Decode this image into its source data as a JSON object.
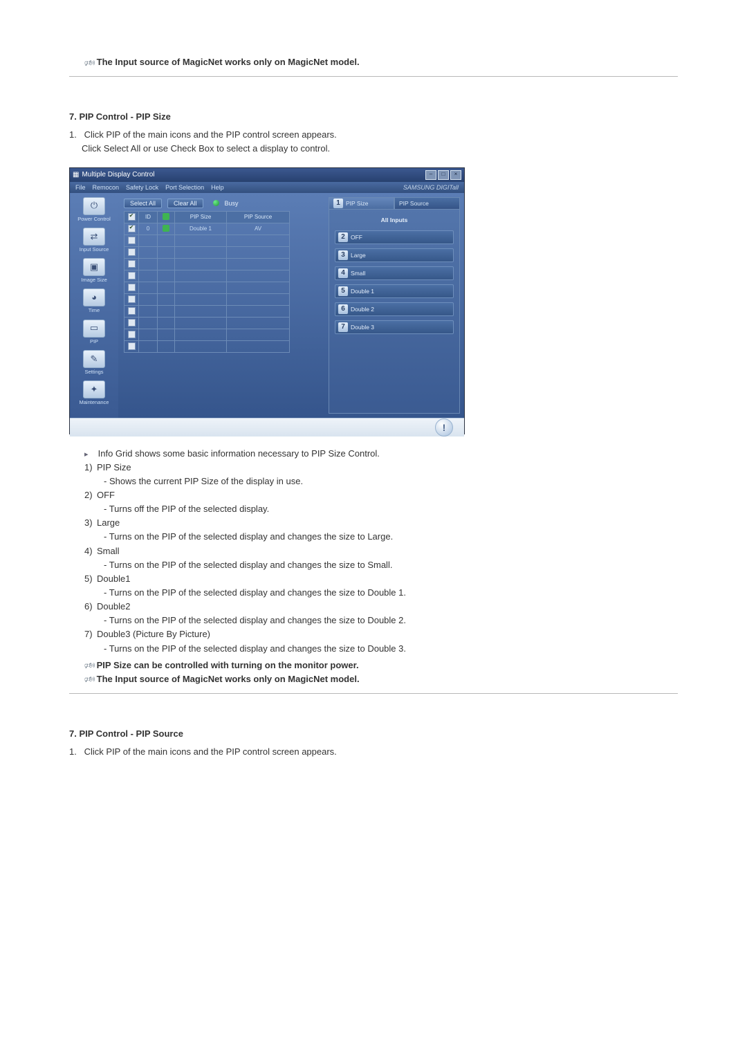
{
  "notes": {
    "magicnet": "The Input source of MagicNet works only on MagicNet model.",
    "pip_power": "PIP Size can be controlled with turning on the monitor power."
  },
  "pip_size": {
    "heading": "7. PIP Control - PIP Size",
    "instructions": [
      "Click PIP of the main icons and the PIP control screen appears.",
      "Click Select All or use Check Box to select a display to control."
    ],
    "marker": "1.",
    "info_grid_note": "Info Grid shows some basic information necessary to PIP Size Control.",
    "items": [
      {
        "num": "1)",
        "title": "PIP Size",
        "desc": "- Shows the current PIP Size of the display in use."
      },
      {
        "num": "2)",
        "title": "OFF",
        "desc": "- Turns off the PIP of the selected display."
      },
      {
        "num": "3)",
        "title": "Large",
        "desc": "- Turns on the PIP of the selected display and changes the size to Large."
      },
      {
        "num": "4)",
        "title": "Small",
        "desc": "- Turns on the PIP of the selected display and changes the size to Small."
      },
      {
        "num": "5)",
        "title": "Double1",
        "desc": "- Turns on the PIP of the selected display and changes the size to Double 1."
      },
      {
        "num": "6)",
        "title": "Double2",
        "desc": "- Turns on the PIP of the selected display and changes the size to Double 2."
      },
      {
        "num": "7)",
        "title": "Double3 (Picture By Picture)",
        "desc": "- Turns on the PIP of the selected display and changes the size to Double 3."
      }
    ]
  },
  "pip_source": {
    "heading": "7. PIP Control - PIP Source",
    "marker": "1.",
    "instruction": "Click PIP of the main icons and the PIP control screen appears."
  },
  "app": {
    "title": "Multiple Display Control",
    "menu": [
      "File",
      "Remocon",
      "Safety Lock",
      "Port Selection",
      "Help"
    ],
    "brand": "SAMSUNG DIGITall",
    "toolbar": {
      "select_all": "Select All",
      "clear_all": "Clear All",
      "busy": "Busy"
    },
    "sidebar": [
      {
        "glyph": "⏻",
        "label": "Power Control"
      },
      {
        "glyph": "⇄",
        "label": "Input Source"
      },
      {
        "glyph": "▣",
        "label": "Image Size"
      },
      {
        "glyph": "◕",
        "label": "Time"
      },
      {
        "glyph": "▭",
        "label": "PIP"
      },
      {
        "glyph": "✎",
        "label": "Settings"
      },
      {
        "glyph": "✦",
        "label": "Maintenance"
      }
    ],
    "grid": {
      "headers": [
        "",
        "ID",
        "",
        "PIP Size",
        "PIP Source"
      ],
      "row": {
        "id": "0",
        "size": "Double 1",
        "source": "AV"
      },
      "empty_rows": 10
    },
    "panel": {
      "tabs": [
        {
          "num": "1",
          "label": "PIP Size",
          "active": true
        },
        {
          "num": "",
          "label": "PIP Source",
          "active": false
        }
      ],
      "all_inputs": "All Inputs",
      "options": [
        {
          "num": "2",
          "label": "OFF"
        },
        {
          "num": "3",
          "label": "Large"
        },
        {
          "num": "4",
          "label": "Small"
        },
        {
          "num": "5",
          "label": "Double 1"
        },
        {
          "num": "6",
          "label": "Double 2"
        },
        {
          "num": "7",
          "label": "Double 3"
        }
      ]
    }
  }
}
